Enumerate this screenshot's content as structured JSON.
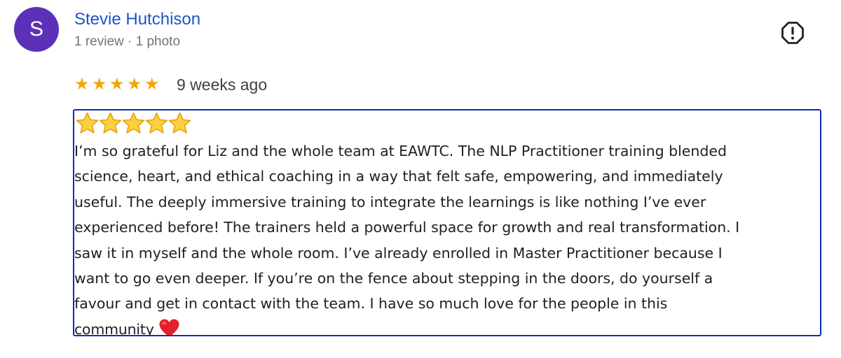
{
  "reviewer": {
    "initial": "S",
    "name": "Stevie Hutchison",
    "meta": "1 review · 1 photo"
  },
  "review": {
    "rating": 5,
    "max_rating": 5,
    "date": "9 weeks ago",
    "emoji_star_count": 5,
    "text_lines": [
      "I’m so grateful for Liz and the whole team at EAWTC. The NLP Practitioner training blended",
      "science, heart, and ethical coaching in a way that felt safe, empowering, and immediately",
      "useful. The deeply immersive training to integrate the learnings is like nothing I’ve ever",
      "experienced before! The trainers held a powerful space for growth and real transformation. I",
      "saw it in myself and the whole room. I’ve already enrolled in Master Practitioner because I",
      "want to go even deeper. If you’re on the fence about stepping in the doors, do yourself a",
      "favour and get in contact with the team. I have so much love for the people in this",
      "community"
    ],
    "end_emoji": "red-heart-emoji"
  },
  "icons": {
    "report": "report-flag-icon",
    "rating_star": "star-icon",
    "emoji_star": "star-emoji"
  },
  "colors": {
    "avatar_bg": "#5c30b8",
    "name_link": "#1a56c8",
    "rating_star": "#f2a60c",
    "emoji_star_fill": "#fbd140",
    "emoji_star_stroke": "#e8a20e",
    "highlight_border": "#0d2fb3",
    "heart": "#e5202e"
  }
}
